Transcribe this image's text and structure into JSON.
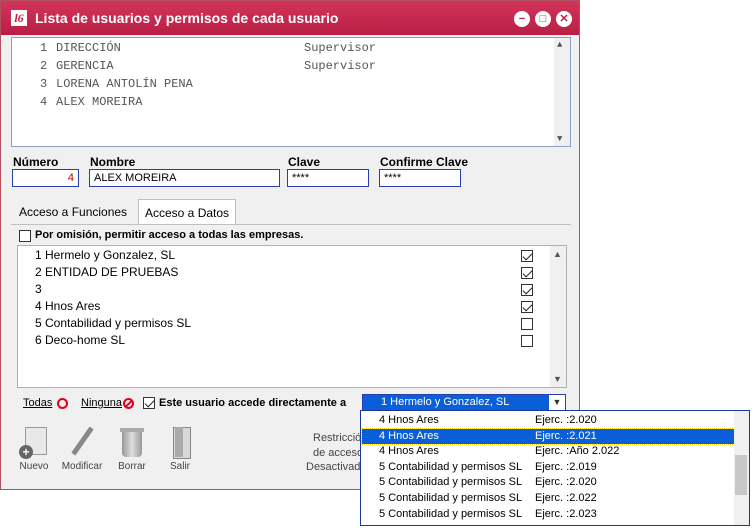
{
  "window": {
    "title": "Lista de usuarios y permisos de cada usuario",
    "app_icon": "l6"
  },
  "users": [
    {
      "num": "1",
      "name": "DIRECCIÓN",
      "role": "Supervisor"
    },
    {
      "num": "2",
      "name": "GERENCIA",
      "role": "Supervisor"
    },
    {
      "num": "3",
      "name": "LORENA ANTOLÍN PENA",
      "role": ""
    },
    {
      "num": "4",
      "name": "ALEX MOREIRA",
      "role": ""
    }
  ],
  "form": {
    "numero_label": "Número",
    "numero": "4",
    "nombre_label": "Nombre",
    "nombre": "ALEX MOREIRA",
    "clave_label": "Clave",
    "clave": "****",
    "confirme_label": "Confirme Clave",
    "confirme": "****"
  },
  "tabs": [
    {
      "label": "Acceso a Funciones"
    },
    {
      "label": "Acceso a Datos"
    }
  ],
  "default_access_label": "Por omisión, permitir acceso a todas las empresas.",
  "companies": [
    {
      "label": "1 Hermelo y Gonzalez, SL",
      "checked": true
    },
    {
      "label": "2 ENTIDAD DE PRUEBAS",
      "checked": true
    },
    {
      "label": "3",
      "checked": true
    },
    {
      "label": "4 Hnos Ares",
      "checked": true
    },
    {
      "label": "5 Contabilidad y permisos SL",
      "checked": false
    },
    {
      "label": "6 Deco-home SL",
      "checked": false
    }
  ],
  "bottom": {
    "todas": "Todas",
    "ninguna": "Ninguna",
    "direct_label": "Este usuario accede directamente a",
    "selected": "1 Hermelo y Gonzalez, SL"
  },
  "toolbar": {
    "nuevo": "Nuevo",
    "modificar": "Modificar",
    "borrar": "Borrar",
    "salir": "Salir"
  },
  "status_lines": [
    "Restricció",
    "de acceso",
    "Desactivad"
  ],
  "dropdown": [
    {
      "name": "4 Hnos Ares",
      "ejer": "Ejerc. :2.020"
    },
    {
      "name": "4 Hnos Ares",
      "ejer": "Ejerc. :2.021",
      "selected": true
    },
    {
      "name": "4 Hnos Ares",
      "ejer": "Ejerc. :Año 2.022"
    },
    {
      "name": "5 Contabilidad y permisos SL",
      "ejer": "Ejerc. :2.019"
    },
    {
      "name": "5 Contabilidad y permisos SL",
      "ejer": "Ejerc. :2.020"
    },
    {
      "name": "5 Contabilidad y permisos SL",
      "ejer": "Ejerc. :2.022"
    },
    {
      "name": "5 Contabilidad y permisos SL",
      "ejer": "Ejerc. :2.023"
    }
  ],
  "colors": {
    "titlebar": "#c41d45",
    "selection": "#0a5fd8",
    "field_border": "#2a3eb1"
  }
}
